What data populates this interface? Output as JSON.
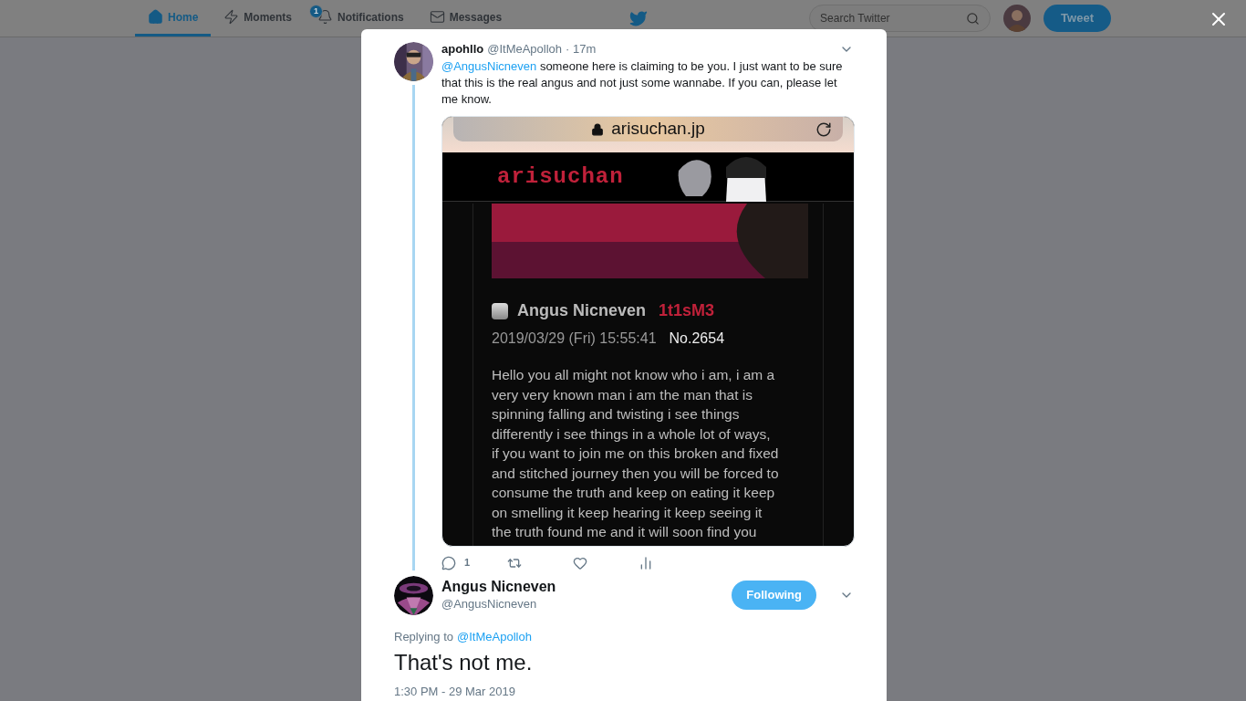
{
  "nav": {
    "items": [
      {
        "kind": "home",
        "label": "Home",
        "selected": true
      },
      {
        "kind": "moments",
        "label": "Moments",
        "selected": false
      },
      {
        "kind": "notifications",
        "label": "Notifications",
        "selected": false,
        "badge": "1"
      },
      {
        "kind": "messages",
        "label": "Messages",
        "selected": false
      }
    ],
    "search": {
      "placeholder": "Search Twitter"
    },
    "tweet_button": "Tweet"
  },
  "tweet": {
    "name": "apohllo",
    "handle": "@ItMeApolloh",
    "time": "· 17m",
    "mention": "@AngusNicneven",
    "text": " someone here is claiming to be you. I just want to be sure that this is the real angus and not just some wannabe. If you can, please let me know.",
    "attachment": {
      "url": "arisuchan.jp",
      "site_name": "arisuchan",
      "checked": false,
      "author": "Angus Nicneven",
      "trip": "1t1sM3",
      "date": "2019/03/29 (Fri) 15:55:41",
      "number": "No.2654",
      "lines": [
        "Hello you all might not know who i am, i am a",
        "very very known man i am the man that is",
        "spinning falling and twisting i see things",
        "differently i see things in a whole lot of ways,",
        "if you want to join me on this broken and fixed",
        "and stitched journey then you will be forced to",
        "consume the truth and keep on eating it keep",
        "on smelling it keep hearing it keep seeing it",
        "the truth found me and it will soon find you"
      ]
    },
    "actions": [
      {
        "kind": "reply",
        "count": "1"
      },
      {
        "kind": "retweet"
      },
      {
        "kind": "like"
      },
      {
        "kind": "analytics"
      }
    ]
  },
  "reply": {
    "name": "Angus Nicneven",
    "handle": "@AngusNicneven",
    "follow_button": "Following",
    "replying_label": "Replying to",
    "replying_to": "@ItMeApolloh",
    "text": "That's not me.",
    "timestamp": "1:30 PM - 29 Mar 2019"
  }
}
